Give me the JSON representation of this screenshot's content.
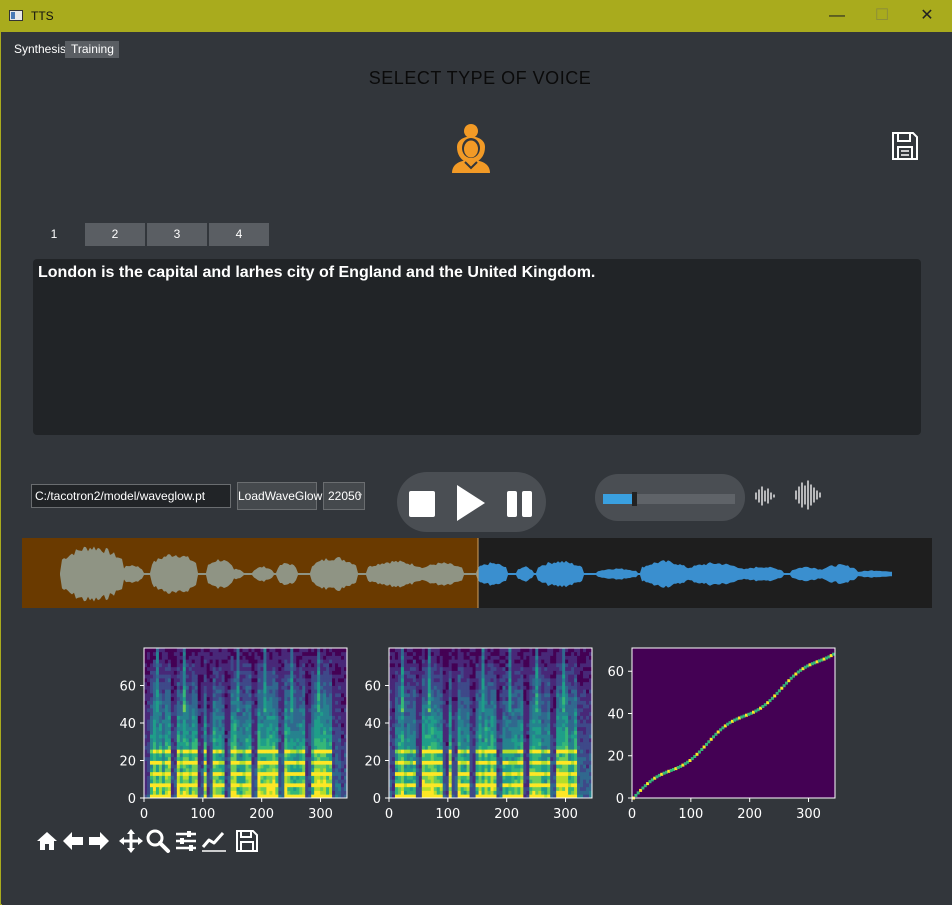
{
  "window": {
    "title": "TTS",
    "minimize_glyph": "—",
    "maximize_glyph": "☐",
    "close_glyph": "✕"
  },
  "mode_tabs": [
    {
      "label": "Synthesis",
      "active": true
    },
    {
      "label": "Training",
      "active": false
    }
  ],
  "heading": "SELECT TYPE OF VOICE",
  "voice_icon": "female-voice-icon",
  "text_tabs": [
    {
      "label": "1",
      "active": true
    },
    {
      "label": "2",
      "active": false
    },
    {
      "label": "3",
      "active": false
    },
    {
      "label": "4",
      "active": false
    }
  ],
  "text_input": {
    "value": "London is the capital and larhes city of England and the United Kingdom."
  },
  "waveglow": {
    "path": "C:/tacotron2/model/waveglow.pt",
    "load_label": "LoadWaveGlow",
    "sample_rate": "22050"
  },
  "player": {
    "progress_fraction": 0.501,
    "volume_fraction": 0.22
  },
  "colors": {
    "titlebar": "#a9ab1d",
    "background": "#32363b",
    "played_region": "#6a3a00",
    "played_wave": "#8f9484",
    "unplayed_region": "#1e1e1e",
    "unplayed_wave": "#3a8fcf",
    "accent": "#3aa0e0",
    "voice_icon": "#f29a26"
  },
  "plots": [
    {
      "name": "mel-spectrogram-target",
      "type": "heatmap",
      "x_ticks": [
        "0",
        "100",
        "200",
        "300"
      ],
      "y_ticks": [
        "0",
        "20",
        "40",
        "60"
      ],
      "xlim": [
        0,
        345
      ],
      "ylim": [
        0,
        80
      ]
    },
    {
      "name": "mel-spectrogram-predicted",
      "type": "heatmap",
      "x_ticks": [
        "0",
        "100",
        "200",
        "300"
      ],
      "y_ticks": [
        "0",
        "20",
        "40",
        "60"
      ],
      "xlim": [
        0,
        345
      ],
      "ylim": [
        0,
        80
      ]
    },
    {
      "name": "alignment",
      "type": "heatmap",
      "x_ticks": [
        "0",
        "100",
        "200",
        "300"
      ],
      "y_ticks": [
        "0",
        "20",
        "40",
        "60"
      ],
      "xlim": [
        0,
        345
      ],
      "ylim": [
        0,
        71
      ]
    }
  ],
  "toolbar_icons": [
    "home-icon",
    "back-arrow-icon",
    "forward-arrow-icon",
    "pan-icon",
    "zoom-icon",
    "configure-subplots-icon",
    "edit-axis-icon",
    "save-figure-icon"
  ]
}
